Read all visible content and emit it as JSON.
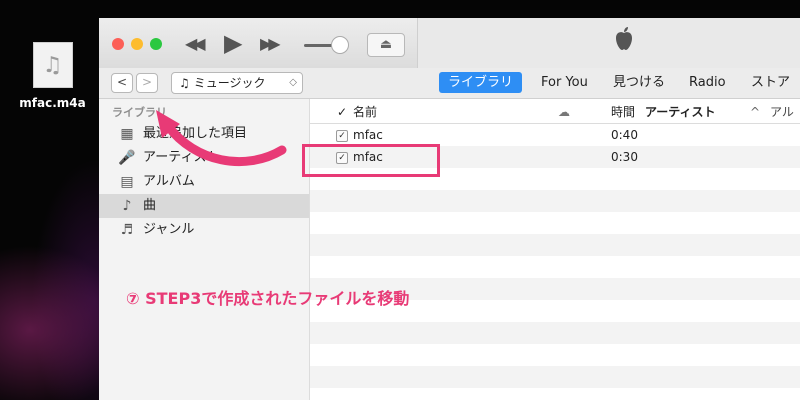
{
  "desktop": {
    "file_name": "mfac.m4a",
    "file_icon": "music-note-icon"
  },
  "titlebar": {
    "controls": [
      "rewind-icon",
      "play-icon",
      "fast-forward-icon",
      "volume-slider",
      "airplay-icon"
    ],
    "logo": "apple-logo-icon"
  },
  "toolbar": {
    "back_glyph": "<",
    "forward_glyph": ">",
    "source_select": "ミュージック",
    "tabs": [
      {
        "label": "ライブラリ",
        "active": true
      },
      {
        "label": "For You",
        "active": false
      },
      {
        "label": "見つける",
        "active": false
      },
      {
        "label": "Radio",
        "active": false
      },
      {
        "label": "ストア",
        "active": false
      }
    ]
  },
  "sidebar": {
    "header": "ライブラリ",
    "items": [
      {
        "label": "最近追加した項目",
        "icon": "grid-icon",
        "selected": false
      },
      {
        "label": "アーティスト",
        "icon": "microphone-icon",
        "selected": false
      },
      {
        "label": "アルバム",
        "icon": "album-icon",
        "selected": false
      },
      {
        "label": "曲",
        "icon": "music-note-icon",
        "selected": true
      },
      {
        "label": "ジャンル",
        "icon": "genre-icon",
        "selected": false
      }
    ]
  },
  "table": {
    "columns": {
      "check": "✓",
      "name": "名前",
      "icloud": "cloud-icon",
      "time": "時間",
      "artist": "アーティスト",
      "album": "アル"
    },
    "sort_indicator": "^",
    "rows": [
      {
        "checked": true,
        "name": "mfac",
        "time": "0:40"
      },
      {
        "checked": true,
        "name": "mfac",
        "time": "0:30"
      }
    ]
  },
  "annotation": {
    "text": "⑦ STEP3で作成されたファイルを移動",
    "color": "#e83a76"
  },
  "colors": {
    "accent": "#2e8ef4",
    "annotation": "#e83a76"
  }
}
